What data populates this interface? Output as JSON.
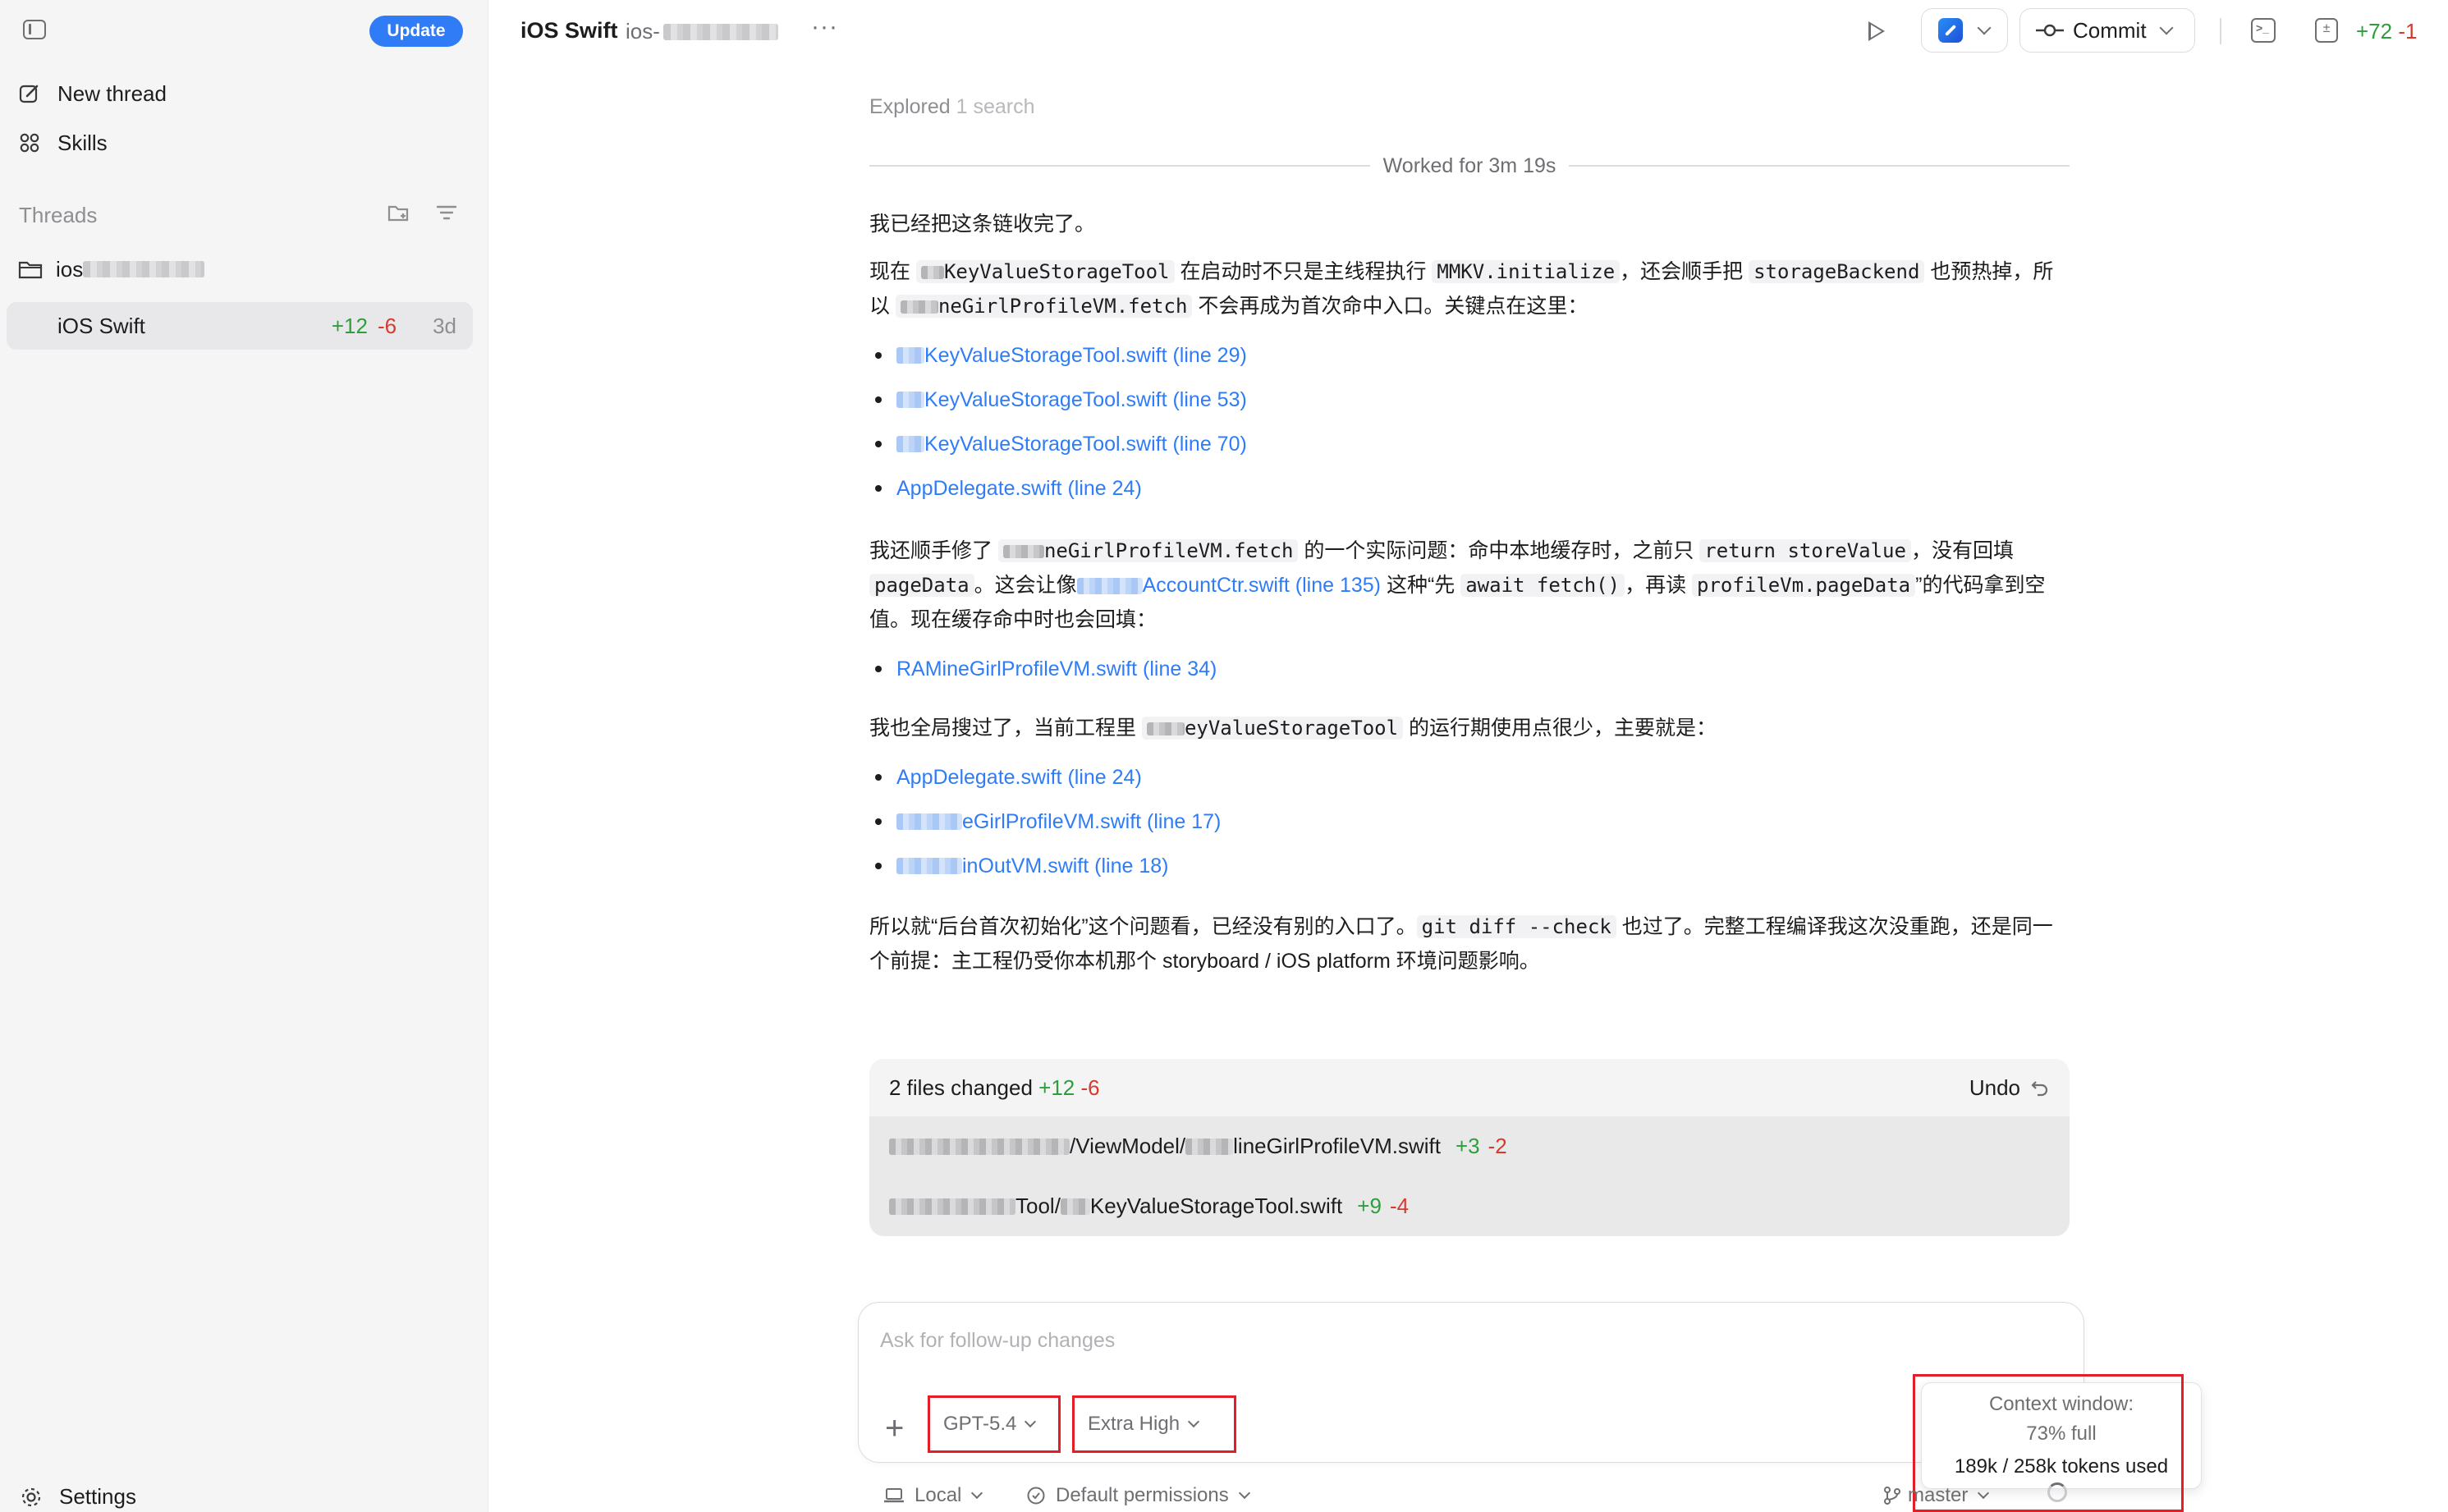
{
  "sidebar": {
    "update_label": "Update",
    "new_thread_label": "New thread",
    "skills_label": "Skills",
    "threads_label": "Threads",
    "folder_label": "ios",
    "thread": {
      "name": "iOS Swift",
      "added": "+12",
      "removed": "-6",
      "age": "3d"
    },
    "settings_label": "Settings"
  },
  "header": {
    "title": "iOS Swift",
    "subtitle": "ios-",
    "commit_label": "Commit",
    "added": "+72",
    "removed": "-1"
  },
  "conversation": {
    "explored_label": "Explored",
    "explored_detail": "1 search",
    "worked_label": "Worked for 3m 19s",
    "p1": "我已经把这条链收完了。",
    "p2": {
      "t1": "现在 ",
      "c1": "KeyValueStorageTool",
      "t2": " 在启动时不只是主线程执行 ",
      "c2": "MMKV.initialize",
      "t3": "，还会顺手把 ",
      "c3": "storageBackend",
      "t4": " 也预热掉，所以 ",
      "c4": "neGirlProfileVM.fetch",
      "t5": " 不会再成为首次命中入口。关键点在这里："
    },
    "list1": [
      "KeyValueStorageTool.swift (line 29)",
      "KeyValueStorageTool.swift (line 53)",
      "KeyValueStorageTool.swift (line 70)",
      "AppDelegate.swift (line 24)"
    ],
    "p3": {
      "t1": "我还顺手修了 ",
      "c1": "neGirlProfileVM.fetch",
      "t2": " 的一个实际问题：命中本地缓存时，之前只 ",
      "c2": "return storeValue",
      "t3": "，没有回填 ",
      "c3": "pageData",
      "t4": "。这会让像",
      "link": "AccountCtr.swift (line 135)",
      "t5": " 这种“先 ",
      "c4": "await fetch()",
      "t6": "，再读 ",
      "c5": "profileVm.pageData",
      "t7": "”的代码拿到空值。现在缓存命中时也会回填："
    },
    "list2": [
      "RAMineGirlProfileVM.swift (line 34)"
    ],
    "p4": {
      "t1": "我也全局搜过了，当前工程里 ",
      "c1": "eyValueStorageTool",
      "t2": " 的运行期使用点很少，主要就是："
    },
    "list3": [
      "AppDelegate.swift (line 24)",
      "eGirlProfileVM.swift (line 17)",
      "inOutVM.swift (line 18)"
    ],
    "p5": {
      "t1": "所以就“后台首次初始化”这个问题看，已经没有别的入口了。",
      "c1": "git diff --check",
      "t2": " 也过了。完整工程编译我这次没重跑，还是同一个前提：主工程仍受你本机那个 storyboard / iOS platform 环境问题影响。"
    }
  },
  "files_changed": {
    "summary": "2 files changed",
    "added": "+12",
    "removed": "-6",
    "undo_label": "Undo",
    "files": [
      {
        "path_a": "/ViewModel/",
        "path_b": "lineGirlProfileVM.swift",
        "added": "+3",
        "removed": "-2"
      },
      {
        "path_a": "Tool/",
        "path_b": "KeyValueStorageTool.swift",
        "added": "+9",
        "removed": "-4"
      }
    ]
  },
  "composer": {
    "placeholder": "Ask for follow-up changes",
    "model": "GPT-5.4",
    "reasoning": "Extra High"
  },
  "context_window": {
    "title": "Context window:",
    "percent_full": "73% full",
    "tokens": "189k / 258k tokens used"
  },
  "footer": {
    "location": "Local",
    "permissions": "Default permissions",
    "branch": "master"
  },
  "colors": {
    "accent": "#2f7cf6",
    "added": "#2e9e3c",
    "removed": "#d63a2f",
    "highlight": "#e41e26"
  }
}
